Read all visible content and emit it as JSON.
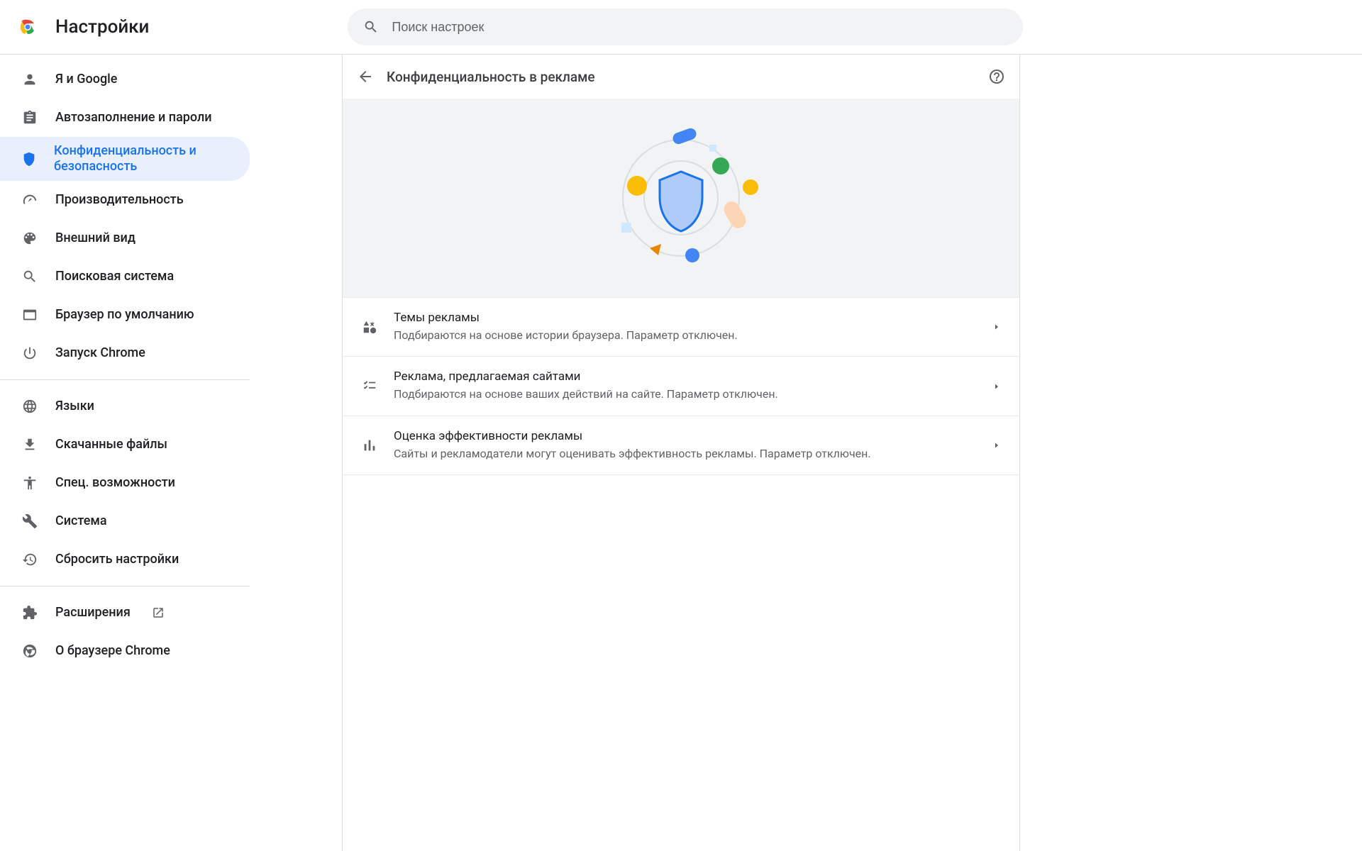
{
  "header": {
    "title": "Настройки",
    "search_placeholder": "Поиск настроек"
  },
  "sidebar": {
    "items": [
      {
        "id": "you-and-google",
        "label": "Я и Google",
        "icon": "person"
      },
      {
        "id": "autofill",
        "label": "Автозаполнение и пароли",
        "icon": "clipboard"
      },
      {
        "id": "privacy",
        "label": "Конфиденциальность и безопасность",
        "icon": "shield",
        "active": true
      },
      {
        "id": "performance",
        "label": "Производительность",
        "icon": "speedometer"
      },
      {
        "id": "appearance",
        "label": "Внешний вид",
        "icon": "palette"
      },
      {
        "id": "search-engine",
        "label": "Поисковая система",
        "icon": "search"
      },
      {
        "id": "default-browser",
        "label": "Браузер по умолчанию",
        "icon": "browser"
      },
      {
        "id": "on-startup",
        "label": "Запуск Chrome",
        "icon": "power"
      }
    ],
    "items2": [
      {
        "id": "languages",
        "label": "Языки",
        "icon": "globe"
      },
      {
        "id": "downloads",
        "label": "Скачанные файлы",
        "icon": "download"
      },
      {
        "id": "accessibility",
        "label": "Спец. возможности",
        "icon": "accessibility"
      },
      {
        "id": "system",
        "label": "Система",
        "icon": "wrench"
      },
      {
        "id": "reset",
        "label": "Сбросить настройки",
        "icon": "restore"
      }
    ],
    "items3": [
      {
        "id": "extensions",
        "label": "Расширения",
        "icon": "extension",
        "external": true
      },
      {
        "id": "about",
        "label": "О браузере Chrome",
        "icon": "chrome"
      }
    ]
  },
  "panel": {
    "title": "Конфиденциальность в рекламе",
    "rows": [
      {
        "id": "ad-topics",
        "icon": "shapes",
        "title": "Темы рекламы",
        "sub": "Подбираются на основе истории браузера. Параметр отключен."
      },
      {
        "id": "site-suggested-ads",
        "icon": "checklist",
        "title": "Реклама, предлагаемая сайтами",
        "sub": "Подбираются на основе ваших действий на сайте. Параметр отключен."
      },
      {
        "id": "ad-measurement",
        "icon": "bar-chart",
        "title": "Оценка эффективности рекламы",
        "sub": "Сайты и рекламодатели могут оценивать эффективность рекламы. Параметр отключен."
      }
    ]
  }
}
